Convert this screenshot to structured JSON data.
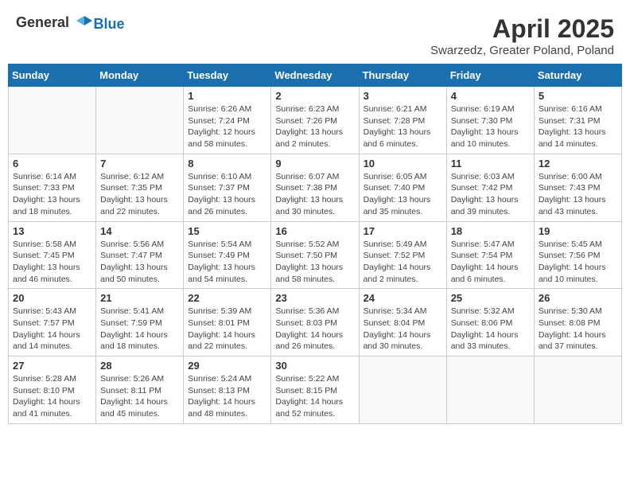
{
  "logo": {
    "general": "General",
    "blue": "Blue"
  },
  "title": {
    "month": "April 2025",
    "location": "Swarzedz, Greater Poland, Poland"
  },
  "weekdays": [
    "Sunday",
    "Monday",
    "Tuesday",
    "Wednesday",
    "Thursday",
    "Friday",
    "Saturday"
  ],
  "weeks": [
    [
      {
        "day": "",
        "info": ""
      },
      {
        "day": "",
        "info": ""
      },
      {
        "day": "1",
        "info": "Sunrise: 6:26 AM\nSunset: 7:24 PM\nDaylight: 12 hours and 58 minutes."
      },
      {
        "day": "2",
        "info": "Sunrise: 6:23 AM\nSunset: 7:26 PM\nDaylight: 13 hours and 2 minutes."
      },
      {
        "day": "3",
        "info": "Sunrise: 6:21 AM\nSunset: 7:28 PM\nDaylight: 13 hours and 6 minutes."
      },
      {
        "day": "4",
        "info": "Sunrise: 6:19 AM\nSunset: 7:30 PM\nDaylight: 13 hours and 10 minutes."
      },
      {
        "day": "5",
        "info": "Sunrise: 6:16 AM\nSunset: 7:31 PM\nDaylight: 13 hours and 14 minutes."
      }
    ],
    [
      {
        "day": "6",
        "info": "Sunrise: 6:14 AM\nSunset: 7:33 PM\nDaylight: 13 hours and 18 minutes."
      },
      {
        "day": "7",
        "info": "Sunrise: 6:12 AM\nSunset: 7:35 PM\nDaylight: 13 hours and 22 minutes."
      },
      {
        "day": "8",
        "info": "Sunrise: 6:10 AM\nSunset: 7:37 PM\nDaylight: 13 hours and 26 minutes."
      },
      {
        "day": "9",
        "info": "Sunrise: 6:07 AM\nSunset: 7:38 PM\nDaylight: 13 hours and 30 minutes."
      },
      {
        "day": "10",
        "info": "Sunrise: 6:05 AM\nSunset: 7:40 PM\nDaylight: 13 hours and 35 minutes."
      },
      {
        "day": "11",
        "info": "Sunrise: 6:03 AM\nSunset: 7:42 PM\nDaylight: 13 hours and 39 minutes."
      },
      {
        "day": "12",
        "info": "Sunrise: 6:00 AM\nSunset: 7:43 PM\nDaylight: 13 hours and 43 minutes."
      }
    ],
    [
      {
        "day": "13",
        "info": "Sunrise: 5:58 AM\nSunset: 7:45 PM\nDaylight: 13 hours and 46 minutes."
      },
      {
        "day": "14",
        "info": "Sunrise: 5:56 AM\nSunset: 7:47 PM\nDaylight: 13 hours and 50 minutes."
      },
      {
        "day": "15",
        "info": "Sunrise: 5:54 AM\nSunset: 7:49 PM\nDaylight: 13 hours and 54 minutes."
      },
      {
        "day": "16",
        "info": "Sunrise: 5:52 AM\nSunset: 7:50 PM\nDaylight: 13 hours and 58 minutes."
      },
      {
        "day": "17",
        "info": "Sunrise: 5:49 AM\nSunset: 7:52 PM\nDaylight: 14 hours and 2 minutes."
      },
      {
        "day": "18",
        "info": "Sunrise: 5:47 AM\nSunset: 7:54 PM\nDaylight: 14 hours and 6 minutes."
      },
      {
        "day": "19",
        "info": "Sunrise: 5:45 AM\nSunset: 7:56 PM\nDaylight: 14 hours and 10 minutes."
      }
    ],
    [
      {
        "day": "20",
        "info": "Sunrise: 5:43 AM\nSunset: 7:57 PM\nDaylight: 14 hours and 14 minutes."
      },
      {
        "day": "21",
        "info": "Sunrise: 5:41 AM\nSunset: 7:59 PM\nDaylight: 14 hours and 18 minutes."
      },
      {
        "day": "22",
        "info": "Sunrise: 5:39 AM\nSunset: 8:01 PM\nDaylight: 14 hours and 22 minutes."
      },
      {
        "day": "23",
        "info": "Sunrise: 5:36 AM\nSunset: 8:03 PM\nDaylight: 14 hours and 26 minutes."
      },
      {
        "day": "24",
        "info": "Sunrise: 5:34 AM\nSunset: 8:04 PM\nDaylight: 14 hours and 30 minutes."
      },
      {
        "day": "25",
        "info": "Sunrise: 5:32 AM\nSunset: 8:06 PM\nDaylight: 14 hours and 33 minutes."
      },
      {
        "day": "26",
        "info": "Sunrise: 5:30 AM\nSunset: 8:08 PM\nDaylight: 14 hours and 37 minutes."
      }
    ],
    [
      {
        "day": "27",
        "info": "Sunrise: 5:28 AM\nSunset: 8:10 PM\nDaylight: 14 hours and 41 minutes."
      },
      {
        "day": "28",
        "info": "Sunrise: 5:26 AM\nSunset: 8:11 PM\nDaylight: 14 hours and 45 minutes."
      },
      {
        "day": "29",
        "info": "Sunrise: 5:24 AM\nSunset: 8:13 PM\nDaylight: 14 hours and 48 minutes."
      },
      {
        "day": "30",
        "info": "Sunrise: 5:22 AM\nSunset: 8:15 PM\nDaylight: 14 hours and 52 minutes."
      },
      {
        "day": "",
        "info": ""
      },
      {
        "day": "",
        "info": ""
      },
      {
        "day": "",
        "info": ""
      }
    ]
  ]
}
